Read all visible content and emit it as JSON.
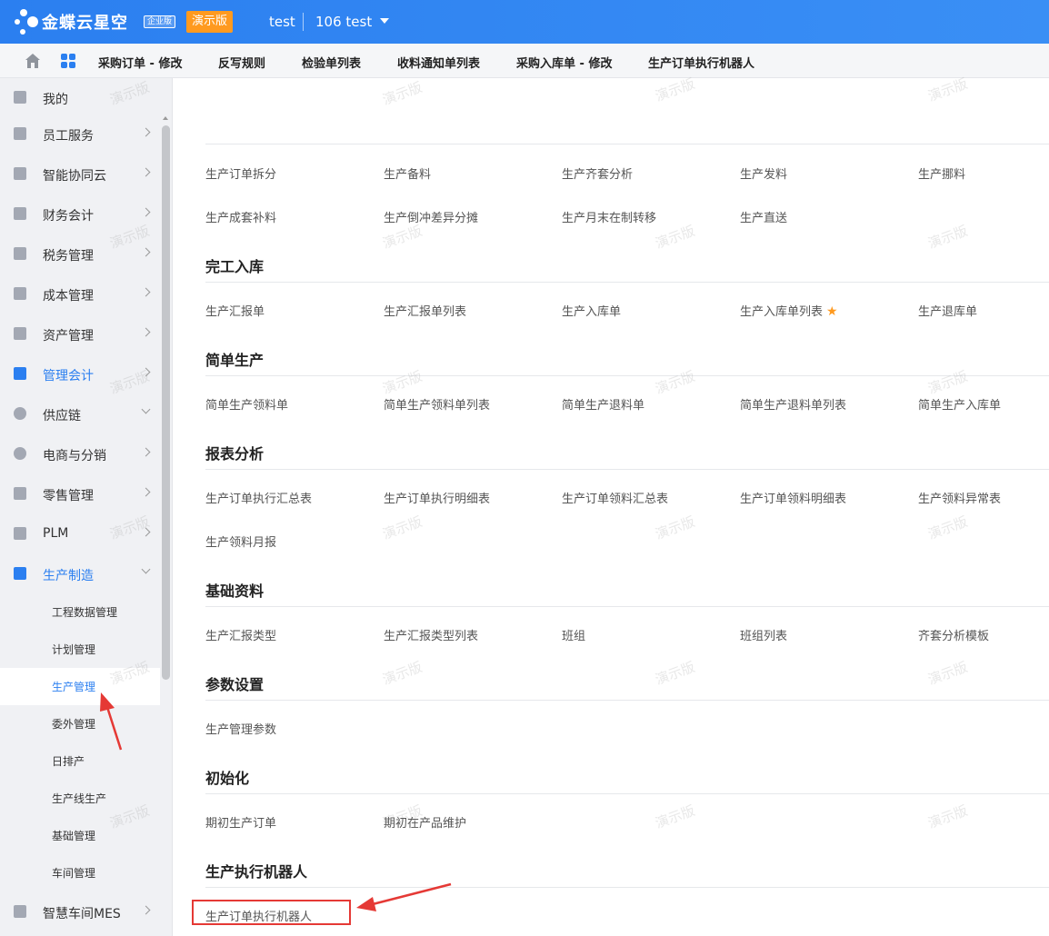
{
  "topbar": {
    "brand": "金蝶云星空",
    "edition": "企业版",
    "demo_label": "演示版",
    "user": "test",
    "org": "106  test"
  },
  "tabs": [
    "采购订单 - 修改",
    "反写规则",
    "检验单列表",
    "收料通知单列表",
    "采购入库单 - 修改",
    "生产订单执行机器人"
  ],
  "sidebar": {
    "items": [
      {
        "label": "我的",
        "chevron": "none"
      },
      {
        "label": "员工服务",
        "chevron": "right"
      },
      {
        "label": "智能协同云",
        "chevron": "right"
      },
      {
        "label": "财务会计",
        "chevron": "right"
      },
      {
        "label": "税务管理",
        "chevron": "right"
      },
      {
        "label": "成本管理",
        "chevron": "right"
      },
      {
        "label": "资产管理",
        "chevron": "right"
      },
      {
        "label": "管理会计",
        "chevron": "right",
        "active": true
      },
      {
        "label": "供应链",
        "chevron": "down"
      },
      {
        "label": "电商与分销",
        "chevron": "right"
      },
      {
        "label": "零售管理",
        "chevron": "right"
      },
      {
        "label": "PLM",
        "chevron": "right"
      },
      {
        "label": "生产制造",
        "chevron": "down",
        "active": true
      }
    ],
    "sub_items": [
      {
        "label": "工程数据管理"
      },
      {
        "label": "计划管理"
      },
      {
        "label": "生产管理",
        "selected": true
      },
      {
        "label": "委外管理"
      },
      {
        "label": "日排产"
      },
      {
        "label": "生产线生产"
      },
      {
        "label": "基础管理"
      },
      {
        "label": "车间管理"
      }
    ],
    "bottom_item": {
      "label": "智慧车间MES",
      "chevron": "right"
    }
  },
  "sections": [
    {
      "title": "",
      "links": [
        "生产订单拆分",
        "生产备料",
        "生产齐套分析",
        "生产发料",
        "生产挪料",
        "生产成套补料",
        "生产倒冲差异分摊",
        "生产月末在制转移",
        "生产直送"
      ]
    },
    {
      "title": "完工入库",
      "links": [
        "生产汇报单",
        "生产汇报单列表",
        "生产入库单",
        "生产入库单列表",
        "生产退库单"
      ]
    },
    {
      "title": "简单生产",
      "links": [
        "简单生产领料单",
        "简单生产领料单列表",
        "简单生产退料单",
        "简单生产退料单列表",
        "简单生产入库单"
      ]
    },
    {
      "title": "报表分析",
      "links": [
        "生产订单执行汇总表",
        "生产订单执行明细表",
        "生产订单领料汇总表",
        "生产订单领料明细表",
        "生产领料异常表",
        "生产领料月报"
      ]
    },
    {
      "title": "基础资料",
      "links": [
        "生产汇报类型",
        "生产汇报类型列表",
        "班组",
        "班组列表",
        "齐套分析模板"
      ]
    },
    {
      "title": "参数设置",
      "links": [
        "生产管理参数"
      ]
    },
    {
      "title": "初始化",
      "links": [
        "期初生产订单",
        "期初在产品维护"
      ]
    },
    {
      "title": "生产执行机器人",
      "links": [
        "生产订单执行机器人"
      ]
    }
  ],
  "watermark": "演示版",
  "colors": {
    "primary": "#2b7ff0",
    "demo": "#ff9a1f",
    "annotation": "#e53935"
  }
}
